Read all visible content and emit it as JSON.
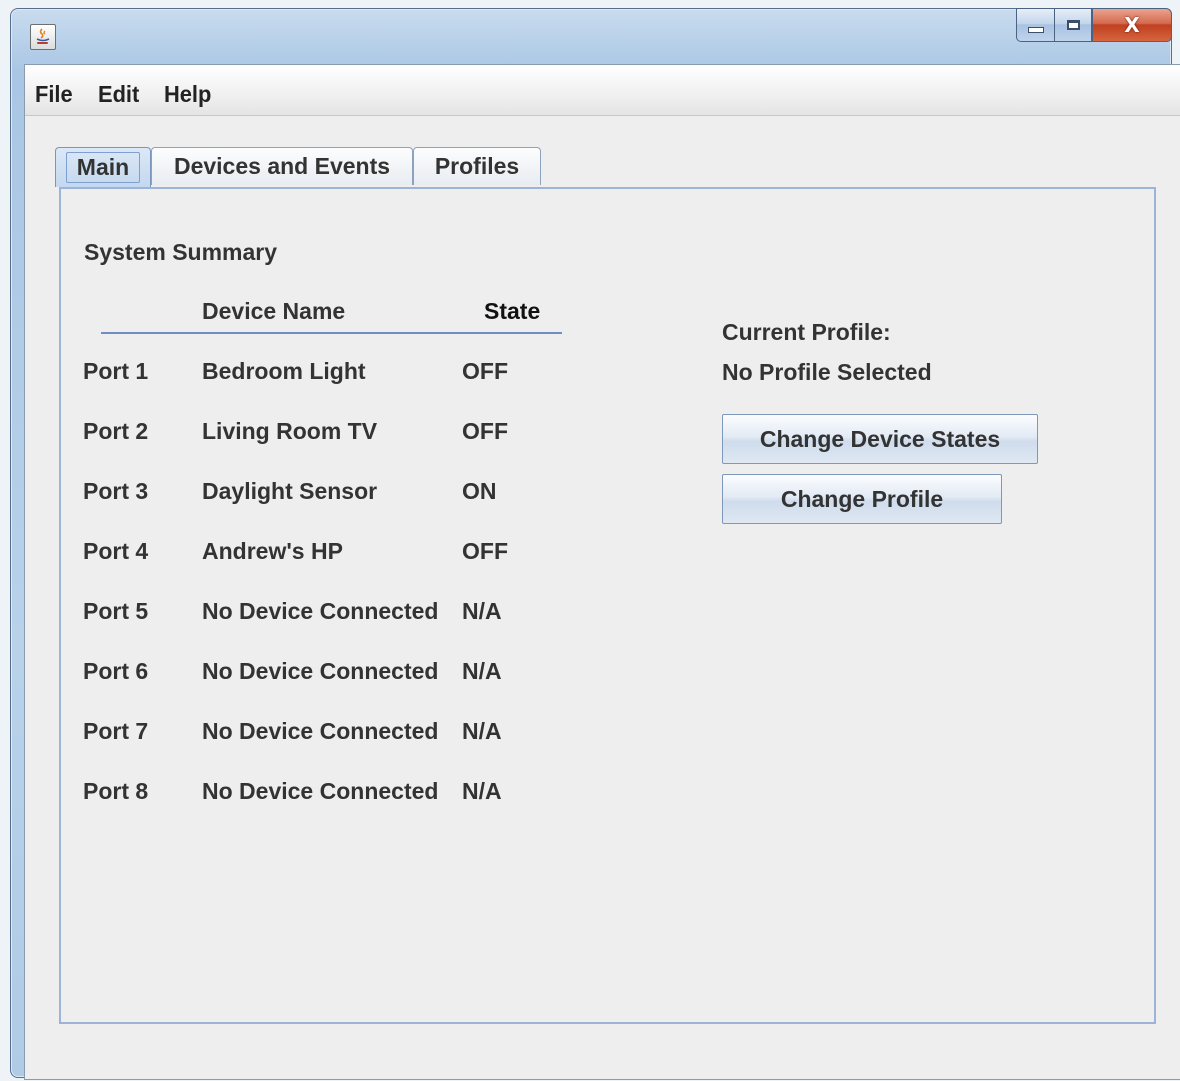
{
  "window": {
    "app_icon": "java-coffee-icon",
    "controls": {
      "minimize": "minimize-icon",
      "maximize": "maximize-icon",
      "close_label": "X"
    }
  },
  "menu": [
    "File",
    "Edit",
    "Help"
  ],
  "tabs": [
    {
      "label": "Main",
      "active": true
    },
    {
      "label": "Devices and Events",
      "active": false
    },
    {
      "label": "Profiles",
      "active": false
    }
  ],
  "summary": {
    "title": "System Summary",
    "col_device": "Device Name",
    "col_state": "State",
    "rows": [
      {
        "port": "Port 1",
        "device": "Bedroom Light",
        "state": "OFF"
      },
      {
        "port": "Port 2",
        "device": "Living Room TV",
        "state": "OFF"
      },
      {
        "port": "Port 3",
        "device": "Daylight Sensor",
        "state": "ON"
      },
      {
        "port": "Port 4",
        "device": "Andrew's HP",
        "state": "OFF"
      },
      {
        "port": "Port 5",
        "device": "No Device Connected",
        "state": "N/A"
      },
      {
        "port": "Port 6",
        "device": "No Device Connected",
        "state": "N/A"
      },
      {
        "port": "Port 7",
        "device": "No Device Connected",
        "state": "N/A"
      },
      {
        "port": "Port 8",
        "device": "No Device Connected",
        "state": "N/A"
      }
    ]
  },
  "profile": {
    "label": "Current Profile:",
    "value": "No Profile Selected"
  },
  "buttons": {
    "change_states": "Change Device States",
    "change_profile": "Change Profile"
  },
  "colors": {
    "accent": "#6f8fbf",
    "panel": "#eeeeee"
  }
}
